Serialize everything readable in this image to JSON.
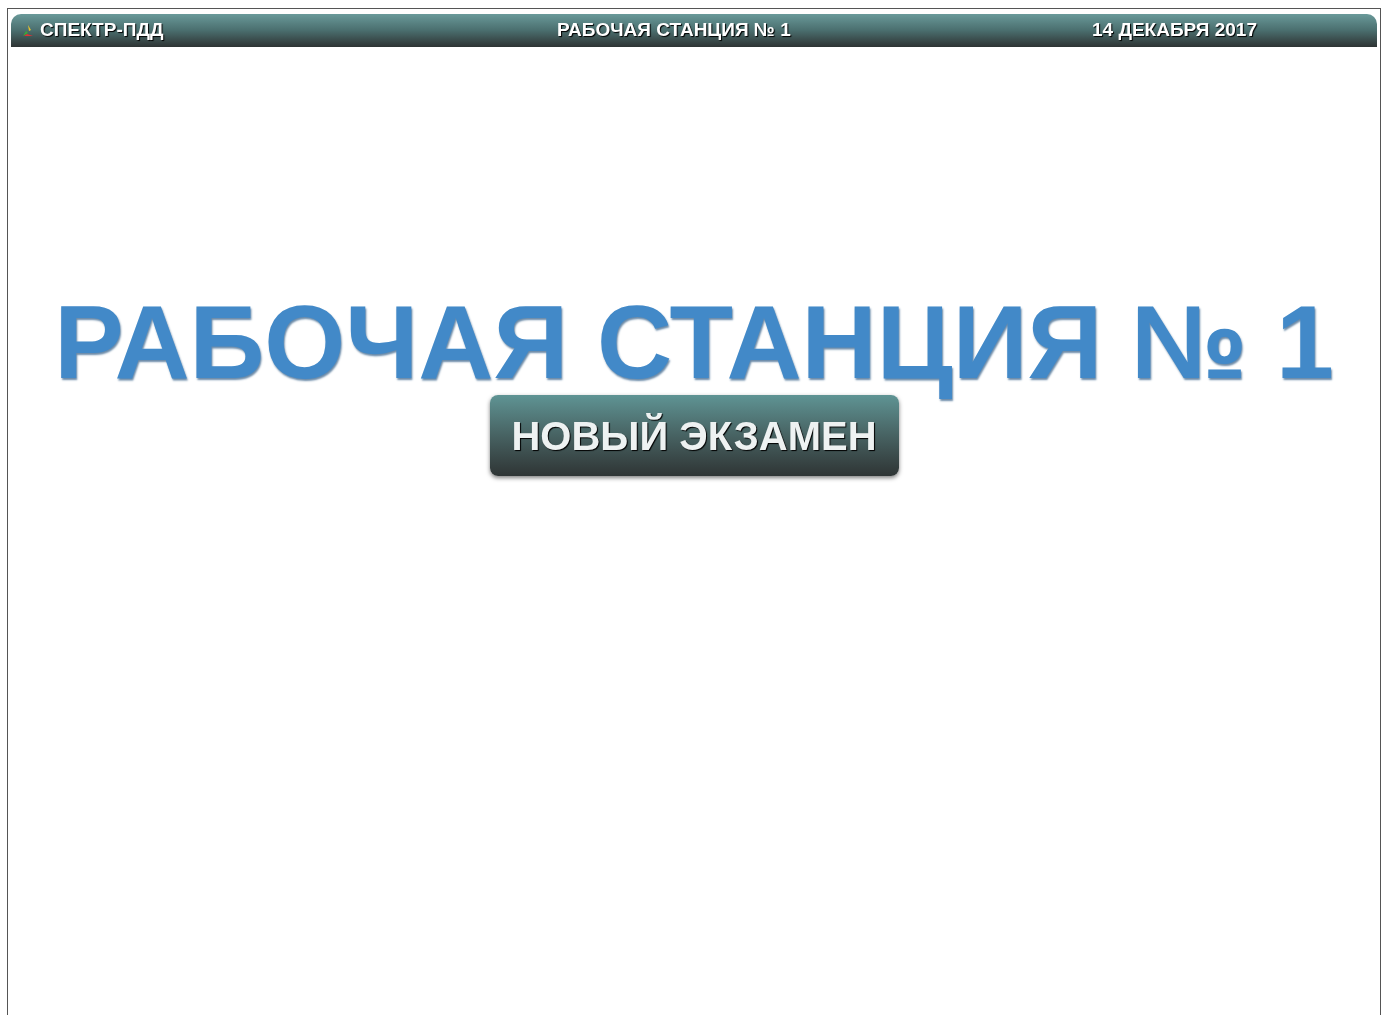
{
  "header": {
    "app_name": "СПЕКТР-ПДД",
    "station": "РАБОЧАЯ СТАНЦИЯ № 1",
    "date": "14 ДЕКАБРЯ 2017"
  },
  "main": {
    "title": "РАБОЧАЯ СТАНЦИЯ № 1",
    "button": "НОВЫЙ ЭКЗАМЕН"
  }
}
